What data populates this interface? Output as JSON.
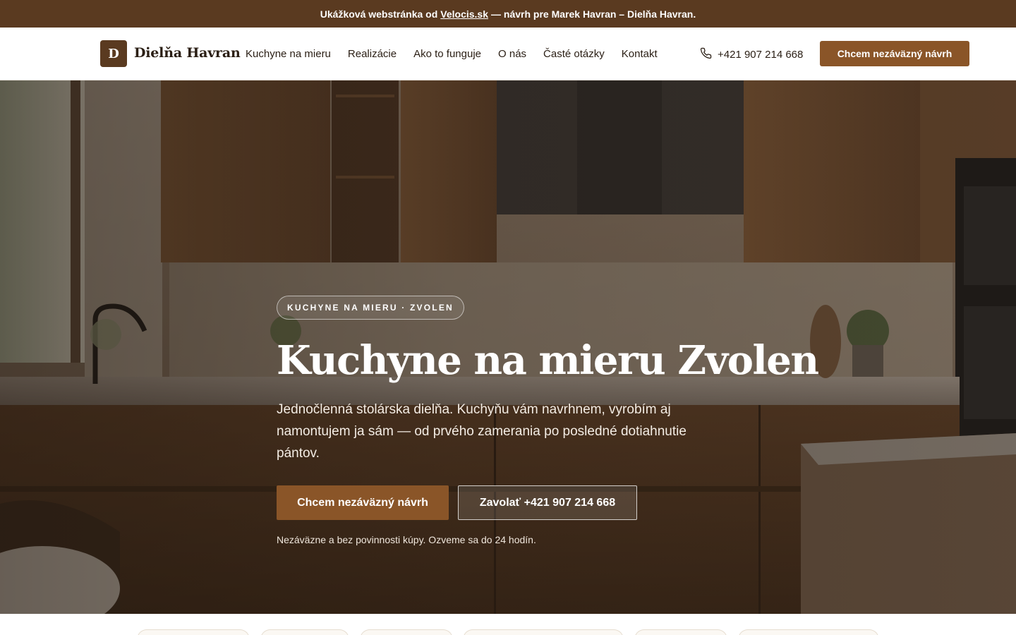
{
  "banner": {
    "prefix": "Ukážková webstránka od",
    "link": "Velocis.sk",
    "suffix": "— návrh pre Marek Havran – Dielňa Havran."
  },
  "header": {
    "logo_letter": "D",
    "logo_text": "Dielňa Havran",
    "nav": [
      {
        "label": "Kuchyne na mieru"
      },
      {
        "label": "Realizácie"
      },
      {
        "label": "Ako to funguje"
      },
      {
        "label": "O nás"
      },
      {
        "label": "Časté otázky"
      },
      {
        "label": "Kontakt"
      }
    ],
    "phone": "+421 907 214 668",
    "phone_icon": "phone-icon",
    "cta": "Chcem nezáväzný návrh"
  },
  "hero": {
    "eyebrow": "KUCHYNE NA MIERU · ZVOLEN",
    "title": "Kuchyne na mieru Zvolen",
    "subtitle": "Jednočlenná stolárska dielňa. Kuchyňu vám navrhnem, vyrobím aj namontujem ja sám — od prvého zamerania po posledné dotiahnutie pántov.",
    "primary_button": "Chcem nezáväzný návrh",
    "secondary_button": "Zavolať +421 907 214 668",
    "note": "Nezáväzne a bez povinnosti kúpy. Ozveme sa do 24 hodín."
  },
  "colors": {
    "brand_dark": "#5a3a20",
    "accent": "#8a5528",
    "background": "#f6f1ea"
  }
}
